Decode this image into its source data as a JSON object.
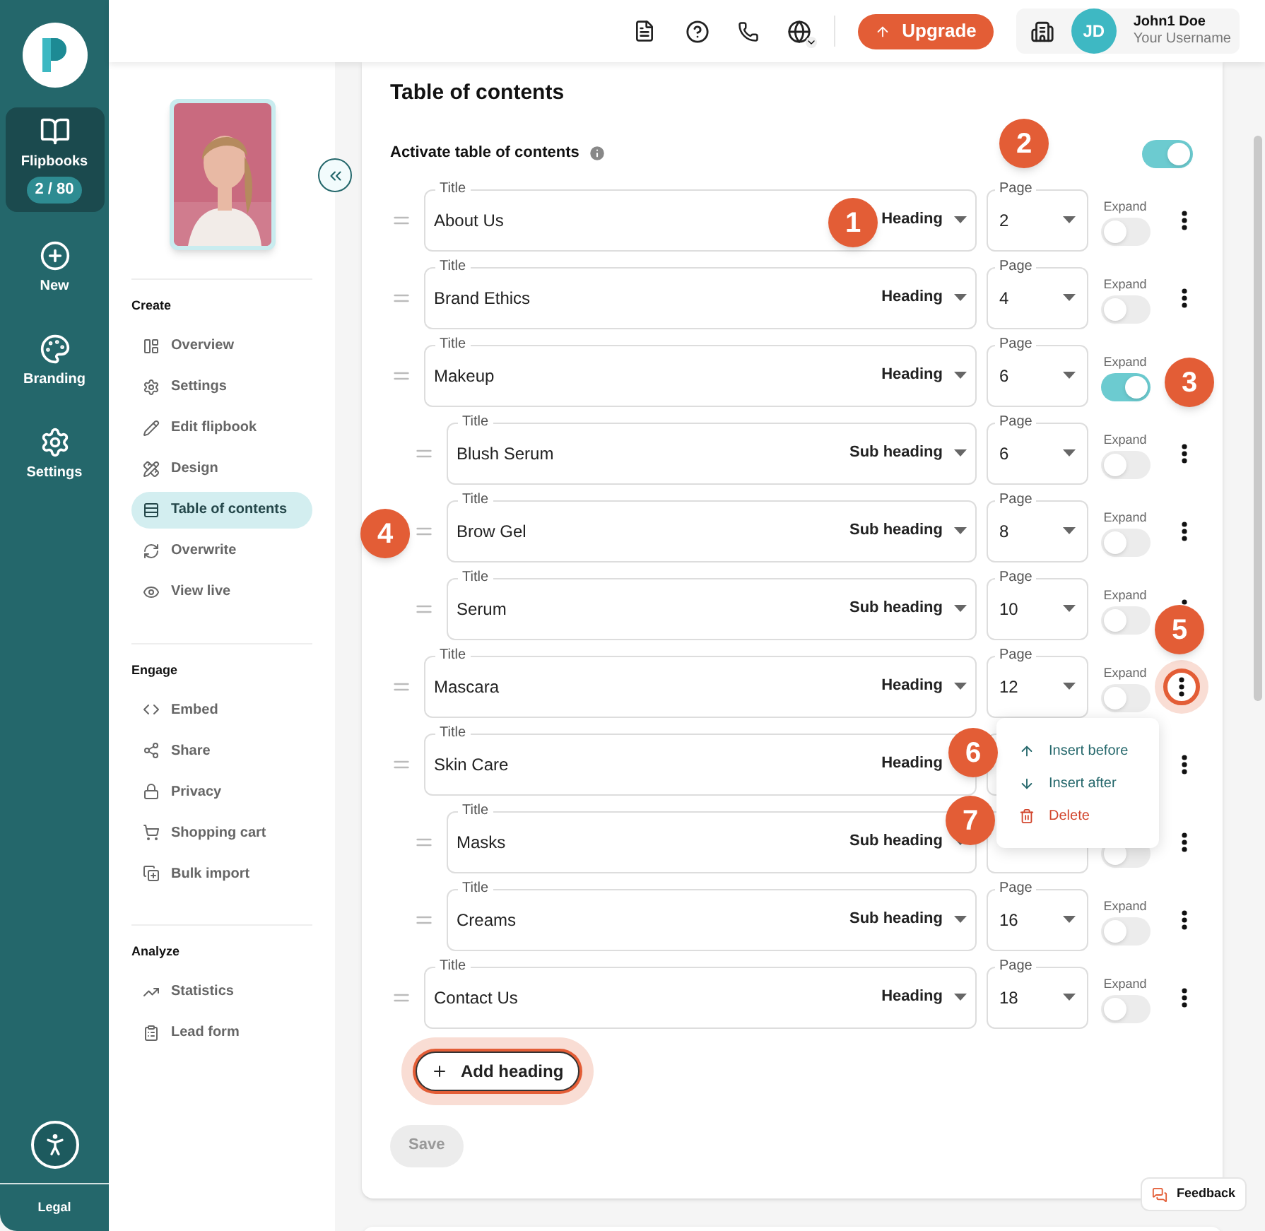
{
  "nav_rail": {
    "items": [
      {
        "label": "Flipbooks",
        "badge": "2 / 80",
        "selected": true
      },
      {
        "label": "New",
        "selected": false
      },
      {
        "label": "Branding",
        "selected": false
      },
      {
        "label": "Settings",
        "selected": false
      }
    ],
    "footer": "Legal"
  },
  "flipbook_sidebar": {
    "sections": [
      {
        "heading": "Create",
        "items": [
          {
            "label": "Overview",
            "selected": false
          },
          {
            "label": "Settings",
            "selected": false
          },
          {
            "label": "Edit flipbook",
            "selected": false
          },
          {
            "label": "Design",
            "selected": false
          },
          {
            "label": "Table of contents",
            "selected": true
          },
          {
            "label": "Overwrite",
            "selected": false
          },
          {
            "label": "View live",
            "selected": false
          }
        ]
      },
      {
        "heading": "Engage",
        "items": [
          {
            "label": "Embed",
            "selected": false
          },
          {
            "label": "Share",
            "selected": false
          },
          {
            "label": "Privacy",
            "selected": false
          },
          {
            "label": "Shopping cart",
            "selected": false
          },
          {
            "label": "Bulk import",
            "selected": false
          }
        ]
      },
      {
        "heading": "Analyze",
        "items": [
          {
            "label": "Statistics",
            "selected": false
          },
          {
            "label": "Lead form",
            "selected": false
          }
        ]
      }
    ]
  },
  "top_bar": {
    "upgrade": "Upgrade",
    "user": {
      "initials": "JD",
      "name": "John1 Doe",
      "username": "Your Username"
    }
  },
  "main": {
    "title": "Table of contents",
    "activate": {
      "label": "Activate table of contents",
      "on": true
    },
    "entries": [
      {
        "kind": "heading",
        "title_label": "Title",
        "title": "About Us",
        "type": "Heading",
        "page_label": "Page",
        "page": "2",
        "expand_label": "Expand",
        "expand": false,
        "menu_open": false
      },
      {
        "kind": "heading",
        "title_label": "Title",
        "title": "Brand Ethics",
        "type": "Heading",
        "page_label": "Page",
        "page": "4",
        "expand_label": "Expand",
        "expand": false,
        "menu_open": false
      },
      {
        "kind": "heading",
        "title_label": "Title",
        "title": "Makeup",
        "type": "Heading",
        "page_label": "Page",
        "page": "6",
        "expand_label": "Expand",
        "expand": true
      },
      {
        "kind": "subheading",
        "title_label": "Title",
        "title": "Blush Serum",
        "type": "Sub heading",
        "page_label": "Page",
        "page": "6",
        "expand_label": "Expand",
        "expand": false,
        "menu_open": false
      },
      {
        "kind": "subheading",
        "title_label": "Title",
        "title": "Brow Gel",
        "type": "Sub heading",
        "page_label": "Page",
        "page": "8",
        "expand_label": "Expand",
        "expand": false,
        "menu_open": false
      },
      {
        "kind": "subheading",
        "title_label": "Title",
        "title": "Serum",
        "type": "Sub heading",
        "page_label": "Page",
        "page": "10",
        "expand_label": "Expand",
        "expand": false,
        "menu_open": false
      },
      {
        "kind": "heading",
        "title_label": "Title",
        "title": "Mascara",
        "type": "Heading",
        "page_label": "Page",
        "page": "12",
        "expand_label": "Expand",
        "expand": false,
        "menu_open": true
      },
      {
        "kind": "heading",
        "title_label": "Title",
        "title": "Skin Care",
        "type": "Heading",
        "menu_open": false
      },
      {
        "kind": "subheading",
        "title_label": "Title",
        "title": "Masks",
        "type": "Sub heading",
        "expand": false,
        "menu_open": false
      },
      {
        "kind": "subheading",
        "title_label": "Title",
        "title": "Creams",
        "type": "Sub heading",
        "page_label": "Page",
        "page": "16",
        "expand_label": "Expand",
        "expand": false,
        "menu_open": false
      },
      {
        "kind": "heading",
        "title_label": "Title",
        "title": "Contact Us",
        "type": "Heading",
        "page_label": "Page",
        "page": "18",
        "expand_label": "Expand",
        "expand": false,
        "menu_open": false
      }
    ],
    "add_heading": {
      "label": "Add heading",
      "highlighted": true
    },
    "save": {
      "label": "Save",
      "disabled": true
    }
  },
  "row_menu": {
    "items": [
      {
        "kind": "insert_before",
        "label": "Insert before"
      },
      {
        "kind": "insert_after",
        "label": "Insert after"
      },
      {
        "kind": "delete",
        "label": "Delete"
      }
    ]
  },
  "callouts": [
    "1",
    "2",
    "3",
    "4",
    "5",
    "6",
    "7"
  ],
  "feedback": "Feedback"
}
